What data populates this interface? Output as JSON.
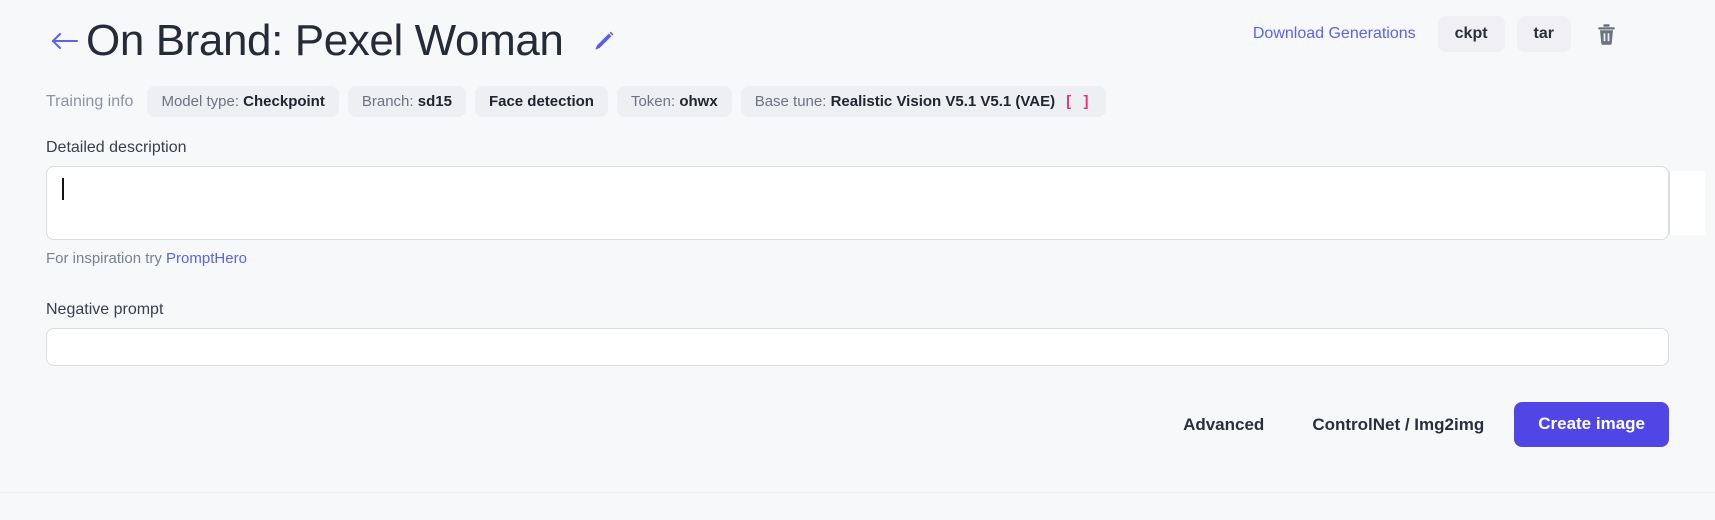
{
  "header": {
    "back_icon": "arrow-left-icon",
    "title": "On Brand: Pexel Woman",
    "edit_icon": "pencil-edit-icon",
    "download_link": "Download Generations",
    "buttons": [
      {
        "label": "ckpt",
        "name": "download-ckpt-button"
      },
      {
        "label": "tar",
        "name": "download-tar-button"
      }
    ],
    "delete_icon": "trash-icon"
  },
  "training_info": {
    "label": "Training info",
    "chips": [
      {
        "label": "Model type:",
        "value": "Checkpoint",
        "brackets": ""
      },
      {
        "label": "Branch:",
        "value": "sd15",
        "brackets": ""
      },
      {
        "label": "Face detection",
        "value": "",
        "brackets": ""
      },
      {
        "label": "Token:",
        "value": "ohwx",
        "brackets": ""
      },
      {
        "label": "Base tune:",
        "value": "Realistic Vision V5.1 V5.1 (VAE)",
        "brackets": "[ ]"
      }
    ]
  },
  "form": {
    "description": {
      "label": "Detailed description",
      "value": "",
      "placeholder": ""
    },
    "hint": {
      "prefix": "For inspiration try ",
      "link": "PromptHero"
    },
    "negative": {
      "label": "Negative prompt",
      "value": "",
      "placeholder": ""
    }
  },
  "actions": {
    "advanced": "Advanced",
    "controlnet": "ControlNet / Img2img",
    "create": "Create  image"
  },
  "colors": {
    "accent": "#5046e5",
    "link": "#5b63e8",
    "background": "#f7f8fa",
    "chip_bg": "#eeeff3",
    "bracket_pink": "#e8327c"
  }
}
